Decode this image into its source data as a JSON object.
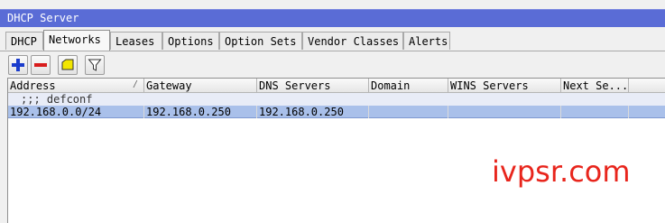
{
  "window": {
    "title": "DHCP Server"
  },
  "tabs": [
    {
      "label": "DHCP",
      "active": false
    },
    {
      "label": "Networks",
      "active": true
    },
    {
      "label": "Leases",
      "active": false
    },
    {
      "label": "Options",
      "active": false
    },
    {
      "label": "Option Sets",
      "active": false
    },
    {
      "label": "Vendor Classes",
      "active": false
    },
    {
      "label": "Alerts",
      "active": false
    }
  ],
  "toolbar": {
    "icons": [
      "add-icon",
      "remove-icon",
      "comment-icon",
      "filter-icon"
    ],
    "colors": {
      "add": "#1a3ccc",
      "remove": "#d81c1c",
      "comment": "#f2e600"
    }
  },
  "table": {
    "columns": [
      "Address",
      "Gateway",
      "DNS Servers",
      "Domain",
      "WINS Servers",
      "Next Se..."
    ],
    "comment": ";;; defconf",
    "rows": [
      [
        "192.168.0.0/24",
        "192.168.0.250",
        "192.168.0.250",
        "",
        "",
        ""
      ]
    ]
  },
  "watermark": "ivpsr.com",
  "colors": {
    "titlebar": "#5a6cd6",
    "selected_row": "#a9c0ea",
    "watermark": "#e8251c"
  }
}
